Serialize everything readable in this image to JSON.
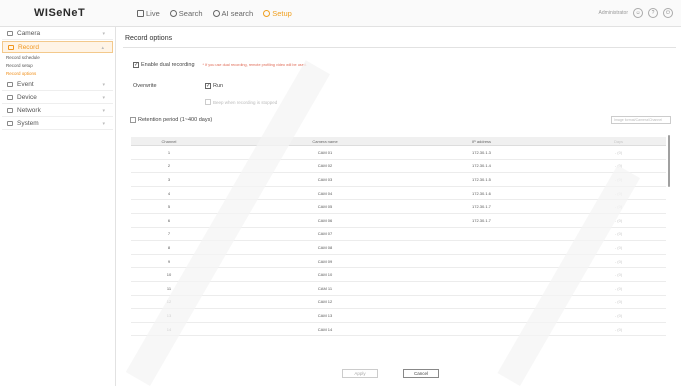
{
  "topbar": {
    "logo": "WISeNeT",
    "nav": [
      {
        "label": "Live",
        "icon": "monitor-icon",
        "active": false
      },
      {
        "label": "Search",
        "icon": "search-icon",
        "active": false
      },
      {
        "label": "AI search",
        "icon": "ai-search-icon",
        "active": false
      },
      {
        "label": "Setup",
        "icon": "gear-icon",
        "active": true
      }
    ],
    "user": "Administrator",
    "accent_color": "#f0961e"
  },
  "sidebar": {
    "menus": [
      {
        "label": "Camera",
        "icon": "camera-icon",
        "active": false
      },
      {
        "label": "Record",
        "icon": "record-icon",
        "active": true
      },
      {
        "label": "Event",
        "icon": "event-icon",
        "active": false
      },
      {
        "label": "Device",
        "icon": "device-icon",
        "active": false
      },
      {
        "label": "Network",
        "icon": "network-icon",
        "active": false
      },
      {
        "label": "System",
        "icon": "system-icon",
        "active": false
      }
    ],
    "record_sub": [
      {
        "label": "Record schedule",
        "active": false
      },
      {
        "label": "Record setup",
        "active": false
      },
      {
        "label": "Record options",
        "active": true
      }
    ]
  },
  "main": {
    "title": "Record options",
    "dual_label": "Enable dual recording",
    "dual_note": "* If you use dual recording, remote profiling video will be used.",
    "overwrite_label": "Overwrite",
    "run_label": "Run",
    "beep_label": "Beep when recording is stopped",
    "retention_label": "Retention period (1~400 days)",
    "search_placeholder": "Image format/Camera/Channel",
    "columns": [
      "Channel",
      "Camera name",
      "IP address",
      "Days"
    ],
    "rows": [
      [
        "1",
        "CAM 01",
        "172.30.1.3",
        "- (0)"
      ],
      [
        "2",
        "CAM 02",
        "172.30.1.4",
        "- (0)"
      ],
      [
        "3",
        "CAM 03",
        "172.30.1.5",
        "- (0)"
      ],
      [
        "4",
        "CAM 04",
        "172.30.1.6",
        "- (0)"
      ],
      [
        "5",
        "CAM 05",
        "172.30.1.7",
        "- (0)"
      ],
      [
        "6",
        "CAM 06",
        "172.30.1.7",
        "- (0)"
      ],
      [
        "7",
        "CAM 07",
        "",
        "- (0)"
      ],
      [
        "8",
        "CAM 08",
        "",
        "- (0)"
      ],
      [
        "9",
        "CAM 09",
        "",
        "- (0)"
      ],
      [
        "10",
        "CAM 10",
        "",
        "- (0)"
      ],
      [
        "11",
        "CAM 11",
        "",
        "- (0)"
      ],
      [
        "12",
        "CAM 12",
        "",
        "- (0)"
      ],
      [
        "13",
        "CAM 13",
        "",
        "- (0)"
      ],
      [
        "14",
        "CAM 14",
        "",
        "- (0)"
      ]
    ],
    "apply_label": "Apply",
    "cancel_label": "Cancel"
  }
}
